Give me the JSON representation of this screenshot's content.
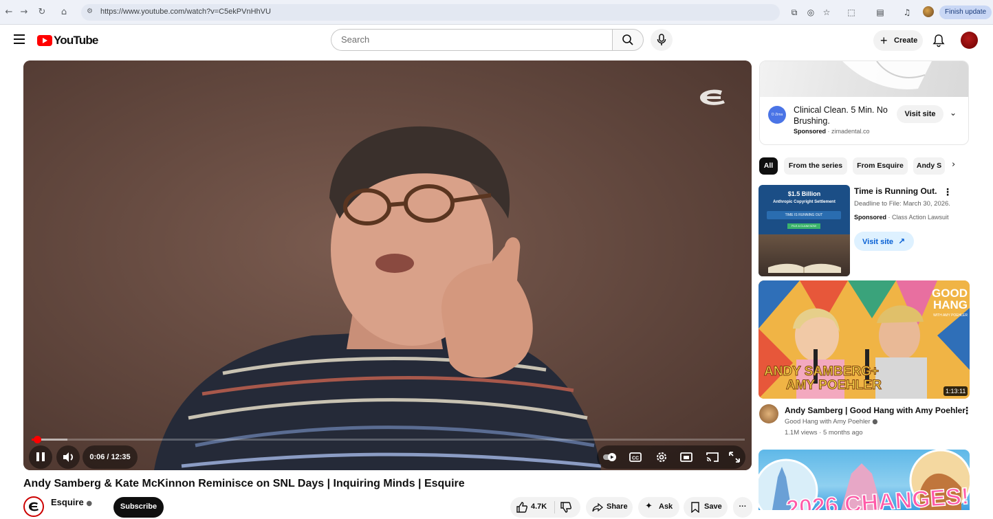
{
  "browser": {
    "url": "https://www.youtube.com/watch?v=C5ekPVnHhVU",
    "finish_update": "Finish update"
  },
  "header": {
    "logo_text": "YouTube",
    "search_placeholder": "Search",
    "create_label": "Create"
  },
  "player": {
    "time": "0:06 / 12:35",
    "progress_fraction": 0.008,
    "buffer_fraction": 0.05
  },
  "video": {
    "title": "Andy Samberg & Kate McKinnon Reminisce on SNL Days | Inquiring Minds | Esquire",
    "channel": "Esquire",
    "subscribe_label": "Subscribe",
    "likes": "4.7K",
    "share_label": "Share",
    "ask_label": "Ask",
    "save_label": "Save"
  },
  "ad_top": {
    "logo_text": "O Zima",
    "headline": "Clinical Clean. 5 Min. No Brushing.",
    "sponsored": "Sponsored",
    "domain": "zimadental.co",
    "visit_label": "Visit site"
  },
  "chips": [
    "All",
    "From the series",
    "From Esquire",
    "Andy S"
  ],
  "ad_side": {
    "thumb_amount": "$1.5 Billion",
    "thumb_line": "Anthropic Copyright Settlement",
    "thumb_badge": "TIME IS RUNNING OUT",
    "thumb_cta": "FILE A CLAIM NOW",
    "title": "Time is Running Out.",
    "subtitle": "Deadline to File: March 30, 2026.",
    "sponsored": "Sponsored",
    "advertiser": "Class Action Lawsuit",
    "visit_label": "Visit site"
  },
  "recommendations": [
    {
      "title": "Andy Samberg | Good Hang with Amy Poehler",
      "channel": "Good Hang with Amy Poehler",
      "views": "1.1M views · 5 months ago",
      "duration": "1:13:11",
      "thumb_top_text": "GOOD HANG",
      "thumb_small_text": "WITH AMY POEHLER",
      "thumb_line1": "ANDY SAMBERG+",
      "thumb_line2": "AMY POEHLER"
    },
    {
      "thumb_text": "2026 CHANGES!"
    }
  ]
}
